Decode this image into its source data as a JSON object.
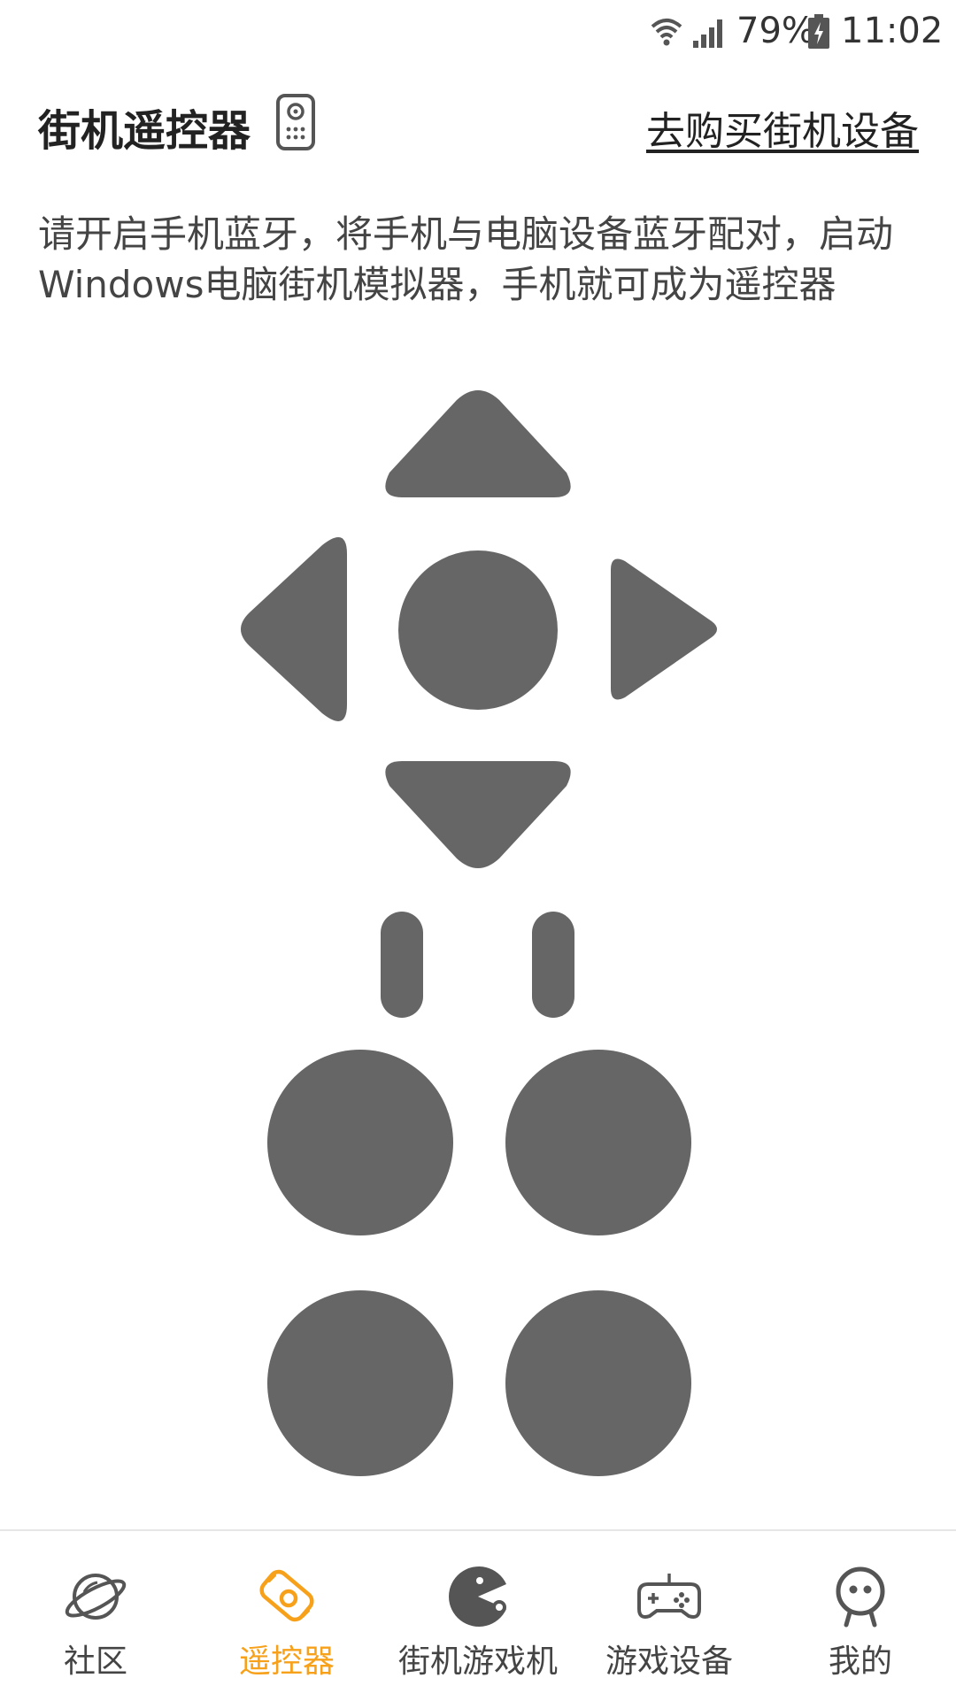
{
  "status_bar": {
    "battery": "79%",
    "time": "11:02",
    "icons": [
      "wifi-icon",
      "signal-icon",
      "battery-charging-icon"
    ]
  },
  "header": {
    "title": "街机遥控器",
    "title_icon": "remote-icon",
    "buy_link": "去购买街机设备"
  },
  "instruction": "请开启手机蓝牙，将手机与电脑设备蓝牙配对，启动Windows电脑街机模拟器，手机就可成为遥控器",
  "controller": {
    "button_color": "#666666",
    "buttons": [
      "dpad-up",
      "dpad-left",
      "dpad-center",
      "dpad-right",
      "dpad-down",
      "select",
      "start",
      "action-a",
      "action-b",
      "action-c",
      "action-d"
    ]
  },
  "bottom_nav": {
    "active_color": "#f7a11b",
    "items": [
      {
        "label": "社区",
        "icon": "planet-icon",
        "active": false
      },
      {
        "label": "遥控器",
        "icon": "remote-icon",
        "active": true
      },
      {
        "label": "街机游戏机",
        "icon": "pacman-icon",
        "active": false
      },
      {
        "label": "游戏设备",
        "icon": "gamepad-icon",
        "active": false
      },
      {
        "label": "我的",
        "icon": "user-icon",
        "active": false
      }
    ]
  }
}
